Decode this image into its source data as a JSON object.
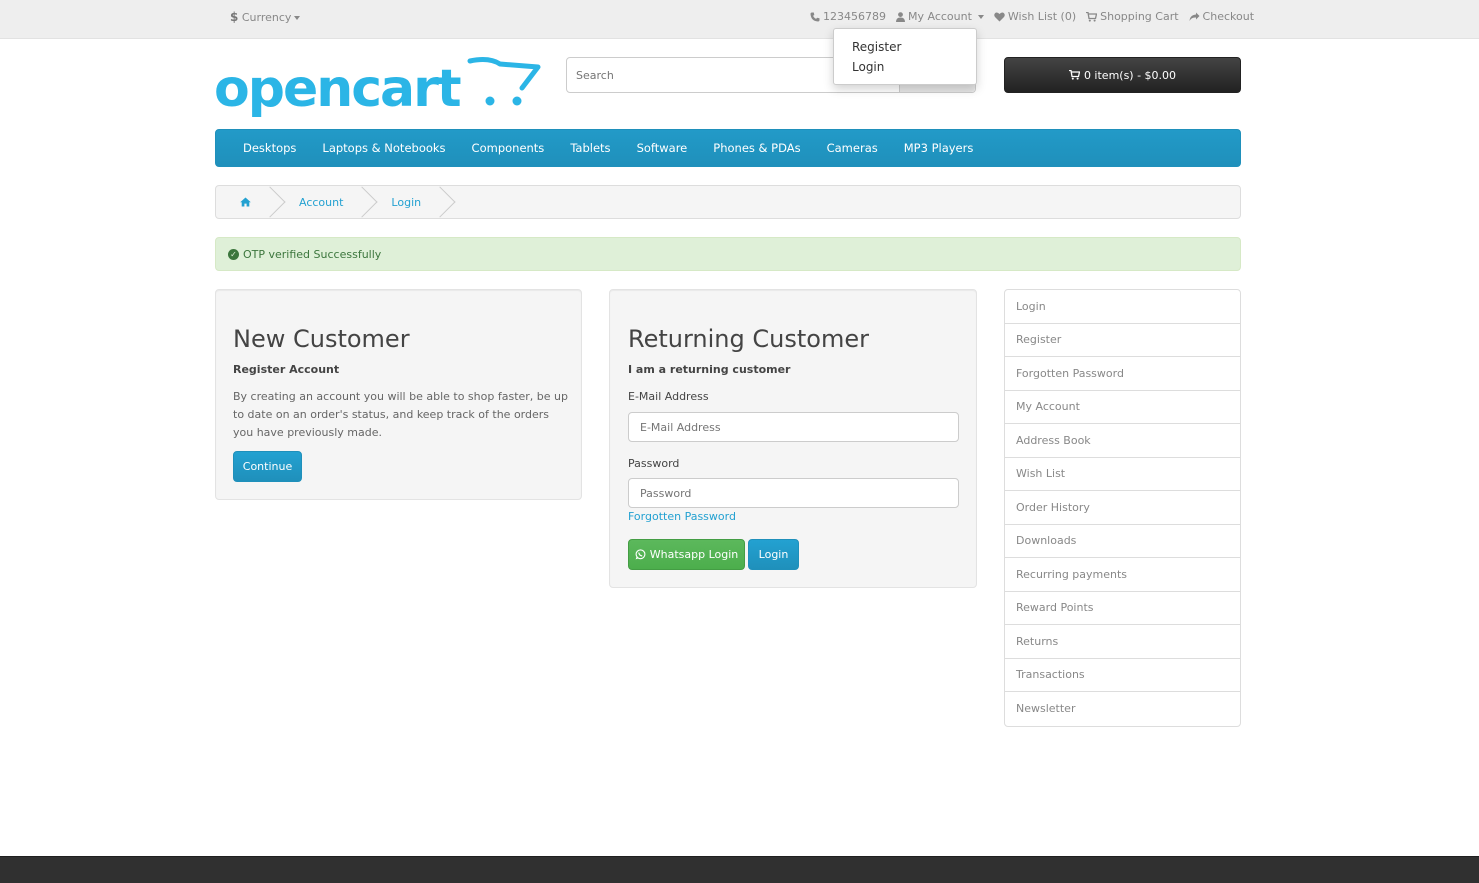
{
  "topbar": {
    "currency_symbol": "$",
    "currency_label": "Currency",
    "phone": "123456789",
    "my_account": "My Account",
    "wishlist": "Wish List (0)",
    "shopping_cart": "Shopping Cart",
    "checkout": "Checkout"
  },
  "account_dropdown": {
    "items": [
      "Register",
      "Login"
    ]
  },
  "header": {
    "logo_text": "opencart",
    "search_placeholder": "Search",
    "cart_label": "0 item(s) - $0.00"
  },
  "menu": {
    "items": [
      "Desktops",
      "Laptops & Notebooks",
      "Components",
      "Tablets",
      "Software",
      "Phones & PDAs",
      "Cameras",
      "MP3 Players"
    ]
  },
  "breadcrumb": {
    "items": [
      "Account",
      "Login"
    ]
  },
  "alert": {
    "message": "OTP verified Successfully"
  },
  "new_customer": {
    "title": "New Customer",
    "subtitle": "Register Account",
    "description": "By creating an account you will be able to shop faster, be up to date on an order's status, and keep track of the orders you have previously made.",
    "continue_label": "Continue"
  },
  "returning_customer": {
    "title": "Returning Customer",
    "subtitle": "I am a returning customer",
    "email_label": "E-Mail Address",
    "email_placeholder": "E-Mail Address",
    "password_label": "Password",
    "password_placeholder": "Password",
    "forgotten_password": "Forgotten Password",
    "whatsapp_login_label": "Whatsapp Login",
    "login_label": "Login"
  },
  "sidebar": {
    "items": [
      "Login",
      "Register",
      "Forgotten Password",
      "My Account",
      "Address Book",
      "Wish List",
      "Order History",
      "Downloads",
      "Recurring payments",
      "Reward Points",
      "Returns",
      "Transactions",
      "Newsletter"
    ]
  },
  "colors": {
    "brand_blue": "#229ac8",
    "success_green": "#5cb85c",
    "alert_bg": "#dff0d8",
    "cart_dark": "#333333",
    "footer_dark": "#303030"
  }
}
